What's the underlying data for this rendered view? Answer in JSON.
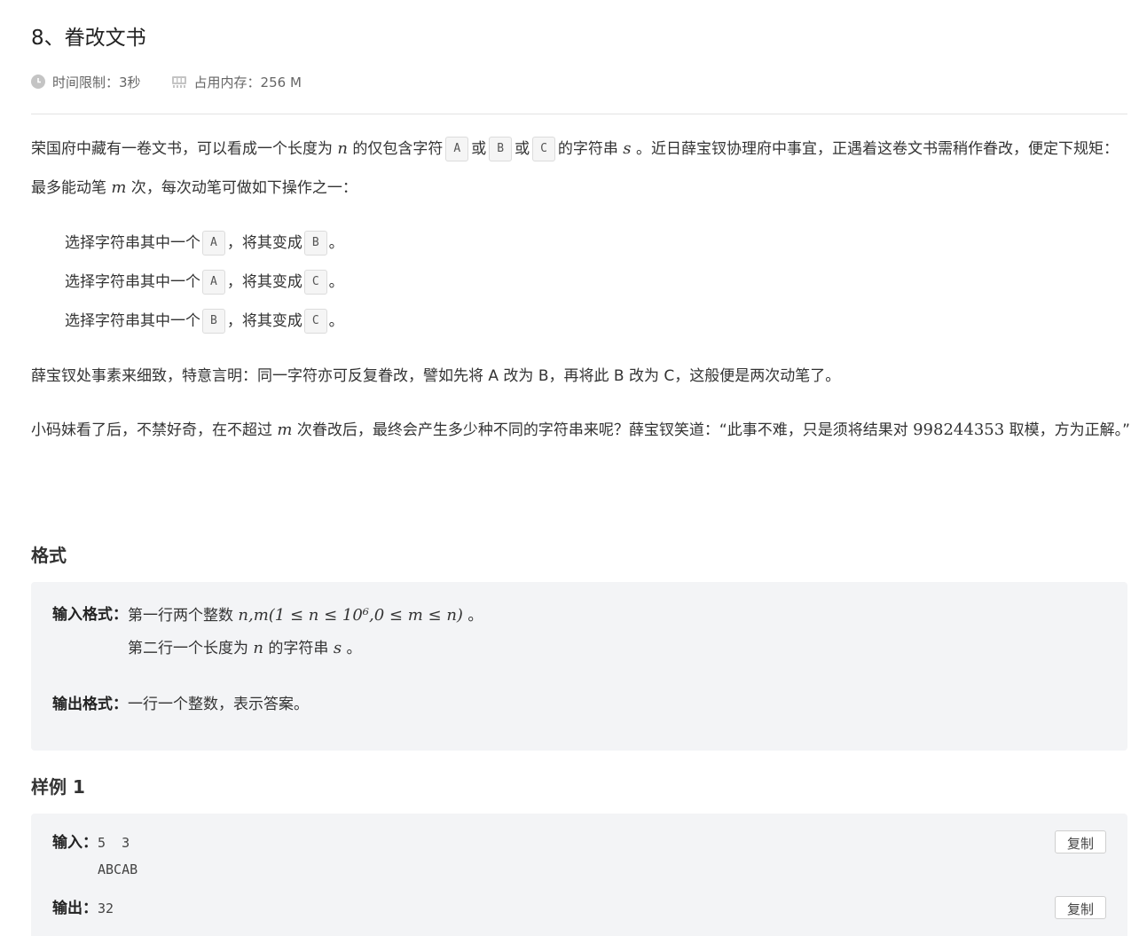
{
  "problem": {
    "title": "8、眷改文书",
    "time_limit": "时间限制：3秒",
    "memory_limit": "占用内存：256 M"
  },
  "statement": {
    "p1_a": "荣国府中藏有一卷文书，可以看成一个长度为",
    "n": "n",
    "p1_b": "的仅包含字符",
    "char_a": "A",
    "or1": "或",
    "char_b": "B",
    "or2": "或",
    "char_c": "C",
    "p1_c": "的字符串",
    "s": "s",
    "p1_d": "。近日薛宝钗协理府中事宜，正遇着这卷文书需稍作眷改，便定下规矩：最多能动笔",
    "m": "m",
    "p1_e": "次，每次动笔可做如下操作之一：",
    "ops": [
      {
        "prefix": "选择字符串其中一个",
        "from": "A",
        "mid": "，将其变成",
        "to": "B",
        "end": "。"
      },
      {
        "prefix": "选择字符串其中一个",
        "from": "A",
        "mid": "，将其变成",
        "to": "C",
        "end": "。"
      },
      {
        "prefix": "选择字符串其中一个",
        "from": "B",
        "mid": "，将其变成",
        "to": "C",
        "end": "。"
      }
    ],
    "p2": "薛宝钗处事素来细致，特意言明：同一字符亦可反复眷改，譬如先将 A 改为 B，再将此 B 改为 C，这般便是两次动笔了。",
    "p3_a": "小码妹看了后，不禁好奇，在不超过",
    "p3_m": "m",
    "p3_b": "次眷改后，最终会产生多少种不同的字符串来呢？薛宝钗笑道：“此事不难，只是须将结果对",
    "modulus": "998244353",
    "p3_c": "取模，方为正解。”"
  },
  "format": {
    "heading": "格式",
    "input_label": "输入格式：",
    "input_line1_text": "第一行两个整数",
    "input_line1_math": "n,m(1 ≤ n ≤ 10⁶,0 ≤ m ≤ n)",
    "input_line1_end": "。",
    "input_line2_a": "第二行一个长度为",
    "input_line2_n": "n",
    "input_line2_b": "的字符串",
    "input_line2_s": "s",
    "input_line2_end": "。",
    "output_label": "输出格式：",
    "output_text": "一行一个整数，表示答案。"
  },
  "sample": {
    "heading": "样例 1",
    "input_label": "输入：",
    "input_line1": "5  3",
    "input_line2": "ABCAB",
    "output_label": "输出：",
    "output_value": "32",
    "copy_label": "复制"
  },
  "colors": {
    "box_bg": "#f3f4f6",
    "divider": "#e3e3e3"
  }
}
